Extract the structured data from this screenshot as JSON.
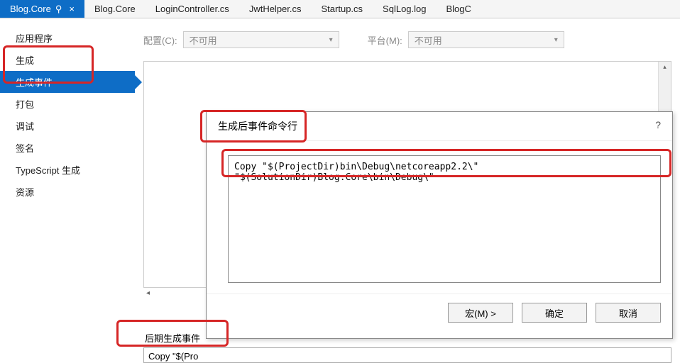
{
  "tabs": [
    {
      "label": "Blog.Core",
      "active": true
    },
    {
      "label": "Blog.Core"
    },
    {
      "label": "LoginController.cs"
    },
    {
      "label": "JwtHelper.cs"
    },
    {
      "label": "Startup.cs"
    },
    {
      "label": "SqlLog.log"
    },
    {
      "label": "BlogC"
    }
  ],
  "sidebar": {
    "items": [
      {
        "label": "应用程序"
      },
      {
        "label": "生成"
      },
      {
        "label": "生成事件",
        "selected": true
      },
      {
        "label": "打包"
      },
      {
        "label": "调试"
      },
      {
        "label": "签名"
      },
      {
        "label": "TypeScript 生成"
      },
      {
        "label": "资源"
      }
    ]
  },
  "config_bar": {
    "config_label": "配置(C):",
    "config_value": "不可用",
    "platform_label": "平台(M):",
    "platform_value": "不可用"
  },
  "bottom": {
    "section_label": "后期生成事件",
    "preview": "Copy \"$(Pro"
  },
  "dialog": {
    "title": "生成后事件命令行",
    "help": "?",
    "command": "Copy \"$(ProjectDir)bin\\Debug\\netcoreapp2.2\\\" \"$(SolutionDir)Blog.Core\\bin\\Debug\\\"",
    "macro_btn": "宏(M) >",
    "ok_btn": "确定",
    "cancel_btn": "取消"
  },
  "icons": {
    "pin": "⚲",
    "close": "×",
    "dropdown": "▾",
    "up": "▴",
    "down": "▾",
    "left": "◂"
  }
}
